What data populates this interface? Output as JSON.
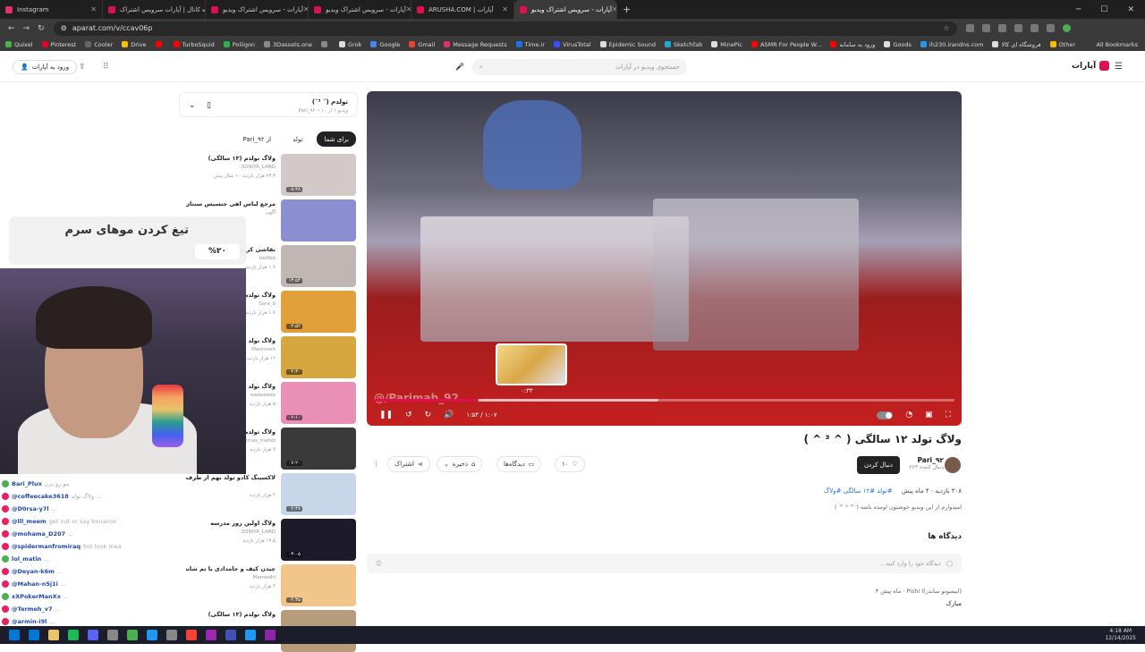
{
  "tabs": [
    {
      "title": "Instagram",
      "color": "#e1306c",
      "active": false
    },
    {
      "title": "سوژه کانال | آپارات سرویس اشتراک",
      "color": "#df0f50",
      "active": false
    },
    {
      "title": "آپارات - سرویس اشتراک ویدیو",
      "color": "#df0f50",
      "active": false
    },
    {
      "title": "آپارات - سرویس اشتراک ویدیو",
      "color": "#df0f50",
      "active": false
    },
    {
      "title": "ARUSHA.COM | آپارات",
      "color": "#df0f50",
      "active": false
    },
    {
      "title": "آپارات - سرویس اشتراک ویدیو",
      "color": "#df0f50",
      "active": true
    }
  ],
  "address": {
    "url": "aparat.com/v/ccav06p"
  },
  "bookmarks": [
    {
      "label": "Quixel",
      "color": "#4caf50"
    },
    {
      "label": "Pinterest",
      "color": "#e60023"
    },
    {
      "label": "Cooler",
      "color": "#666"
    },
    {
      "label": "Drive",
      "color": "#fbbc04"
    },
    {
      "label": "",
      "color": "#ff0000"
    },
    {
      "label": "TurboSquid",
      "color": "#ff0000"
    },
    {
      "label": "Poliigon",
      "color": "#2bb24c"
    },
    {
      "label": "3Dassets.one",
      "color": "#888"
    },
    {
      "label": "",
      "color": "#888"
    },
    {
      "label": "Grok",
      "color": "#ddd"
    },
    {
      "label": "Google",
      "color": "#4285f4"
    },
    {
      "label": "Gmail",
      "color": "#ea4335"
    },
    {
      "label": "Message Requests",
      "color": "#e1306c"
    },
    {
      "label": "Time.ir",
      "color": "#1a73e8"
    },
    {
      "label": "VirusTotal",
      "color": "#394eff"
    },
    {
      "label": "Epidemic Sound",
      "color": "#ddd"
    },
    {
      "label": "Sketchfab",
      "color": "#1caad9"
    },
    {
      "label": "MinePic",
      "color": "#ddd"
    },
    {
      "label": "ASMR For People W...",
      "color": "#ff0000"
    },
    {
      "label": "ورود به سامانه",
      "color": "#ff0000"
    },
    {
      "label": "Goods",
      "color": "#ddd"
    },
    {
      "label": "ih230.irandns.com",
      "color": "#2196f3"
    },
    {
      "label": "فروشگاه ای کالا",
      "color": "#ddd"
    },
    {
      "label": "Other",
      "color": "#fbbc04"
    }
  ],
  "all_bookmarks": "All Bookmarks",
  "header": {
    "login": "ورود به آپارات",
    "search_placeholder": "جستجوی ویدیو در آپارات",
    "logo": "آپارات"
  },
  "player": {
    "watermark": "@/Parimah_92",
    "preview_time": "۰:۳۳",
    "time": "۱:۵۴ / ۱:۰۷",
    "progress": {
      "played": 0.18,
      "buffered": 0.49
    }
  },
  "video": {
    "title": "ولاگ تولد ۱۲ سالگی ( ^ ³ ^ )",
    "channel": "Pari_۹۲",
    "subscribers": "۲۶۳ دنبال کننده",
    "follow": "دنبال کردن",
    "likes": "۱۰",
    "comments_label": "دیدگاه‌ها",
    "save": "ذخیره",
    "share": "اشتراک",
    "views": "۳۰۸ بازدید",
    "age": "۴ ماه پیش",
    "tags": "#تولد  #۱۲ سالگی  #ولاگ",
    "description": "امیدوارم از این ویدیو خوشتون اومده باشه ( ^ ³ ^ )"
  },
  "comments": {
    "title": "دیدگاه ها",
    "placeholder": "دیدگاه خود را وارد کنید...",
    "item": {
      "user": "Pishi (ابیسوتو ساندرا)",
      "time": "۳ ماه پیش",
      "text": "مبارک"
    }
  },
  "playlist": {
    "title": "تولدم (˘ ³˘)",
    "sub": "Pari_۹۲ • ویدیو ۱ از ۱۰"
  },
  "chips": [
    "برای شما",
    "تولد",
    "از Pari_۹۲"
  ],
  "recommended": [
    {
      "title": "ولاگ تولدم (۱۳ سالگی)",
      "channel": "SONIYA_LAND",
      "views": "۲۳.۳ هزار بازدید · ۱ سال پیش",
      "dur": "۰۸:۴۸",
      "color": "#d4c9c9"
    },
    {
      "title": "مرجع لباس اهی جنسیس سنتان",
      "channel": "آگهی",
      "views": "",
      "dur": "",
      "color": "#8a8fd1"
    },
    {
      "title": "نقاشی کردن ...",
      "channel": "bettbb",
      "views": "۱.۷ هزار بازدید",
      "dur": "۱۳:۵۴",
      "color": "#c0b7b5"
    },
    {
      "title": "ولاگ تولدم",
      "channel": "Sara_b",
      "views": "۱.۷ هزار بازدید",
      "dur": "۰۴:۵۲",
      "color": "#e2a03a"
    },
    {
      "title": "ولاگ تولد",
      "channel": "Mastoneh",
      "views": "۱۲ هزار بازدید",
      "dur": "۰۴:۳۰",
      "color": "#d6a73e"
    },
    {
      "title": "ولاگ تولد ۱۲",
      "channel": "eweeeeee",
      "views": "۵ هزار بازدید",
      "dur": "۰۶:۱۰",
      "color": "#ea8fb5"
    },
    {
      "title": "ولاگ تولدم (۱۳ ...)",
      "channel": "elmas_mahdi",
      "views": "۹ هزار بازدید",
      "dur": "۰۷:۲۰",
      "color": "#3a3a3a"
    },
    {
      "title": "لاکسینگ کادو تولد بهم از طرف دوستام",
      "channel": "",
      "views": "۴ هزار بازدید",
      "dur": "۰۲:۴۷",
      "color": "#c7d7e9"
    },
    {
      "title": "ولاگ اولین روز مدرسه",
      "channel": "SONIYA_LAND",
      "views": "۱۳.۵ هزار بازدید",
      "dur": "۰۳:۰۵",
      "color": "#1d1b2a"
    },
    {
      "title": "چیدن کیف و جامدادی با تم شانسی! چ رنگی درومد؟",
      "channel": "Mamedhi",
      "views": "۴ هزار بازدید",
      "dur": "۰۴:۳۵",
      "color": "#f2c58a"
    },
    {
      "title": "ولاگ تولدم (۱۳ سالگی)",
      "channel": "",
      "views": "",
      "dur": "",
      "color": "#b79c7c"
    }
  ],
  "overlay": {
    "title": "تیغ کردن موهای سرم",
    "percent": "%۲۰"
  },
  "chat": [
    {
      "user": "Bari_Plux",
      "msg": "مو رو بزن",
      "color": "#4caf50"
    },
    {
      "user": "@coffeecake3618",
      "msg": "ولاگ تولد ...",
      "color": "#e91e63"
    },
    {
      "user": "@D0rsa-y7l",
      "msg": "...",
      "color": "#e91e63"
    },
    {
      "user": "@lll_meem",
      "msg": "get out or say bonanon",
      "color": "#e91e63"
    },
    {
      "user": "@mohama_D207",
      "msg": "...",
      "color": "#e91e63"
    },
    {
      "user": "@spidermanfromiraq",
      "msg": "bot look mea",
      "color": "#e91e63"
    },
    {
      "user": "lol_matin",
      "msg": "...",
      "color": "#4caf50"
    },
    {
      "user": "@Deyan-k6m",
      "msg": "...",
      "color": "#e91e63"
    },
    {
      "user": "@Mahan-n5j1i",
      "msg": "...",
      "color": "#e91e63"
    },
    {
      "user": "xXPokerManXx",
      "msg": "...",
      "color": "#4caf50"
    },
    {
      "user": "@Termeh_v7",
      "msg": "...",
      "color": "#e91e63"
    },
    {
      "user": "@armin-i9l",
      "msg": "...",
      "color": "#e91e63"
    }
  ],
  "taskbar": {
    "time": "4:18 AM",
    "date": "12/14/2025",
    "icons": [
      "#0078d4",
      "#e9c46a",
      "#1db954",
      "#5865f2",
      "#888",
      "#4caf50",
      "#2196f3",
      "#888",
      "#f44336",
      "#9c27b0",
      "#3f51b5",
      "#2196f3",
      "#8e24aa"
    ]
  }
}
